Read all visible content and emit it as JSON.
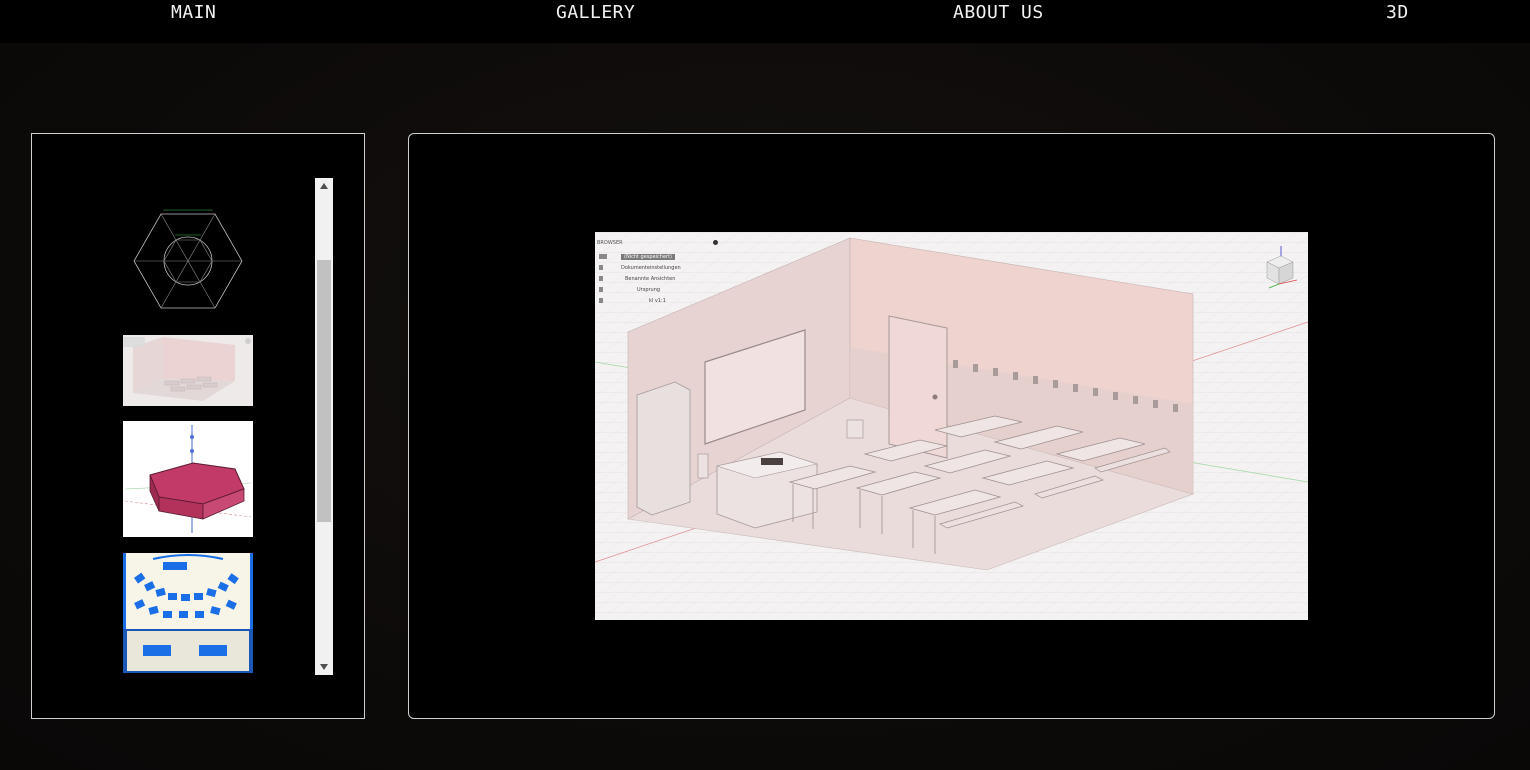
{
  "nav": {
    "items": [
      {
        "label": "MAIN"
      },
      {
        "label": "GALLERY"
      },
      {
        "label": "ABOUT US"
      },
      {
        "label": "3D"
      }
    ]
  },
  "gallery": {
    "thumbnails": [
      {
        "icon": "hexagon-sketch"
      },
      {
        "icon": "classroom-render"
      },
      {
        "icon": "pink-hexagon-prism"
      },
      {
        "icon": "seating-plan"
      }
    ]
  },
  "viewer": {
    "browser_panel": {
      "title": "BROWSER",
      "rows": [
        {
          "label": "(Nicht gespeichert)"
        },
        {
          "label": "Dokumenteinstellungen"
        },
        {
          "label": "Benannte Ansichten"
        },
        {
          "label": "Ursprung"
        },
        {
          "label": "kl v1:1"
        }
      ]
    }
  },
  "colors": {
    "background": "#0d0b0a",
    "navbar": "#000000",
    "panel_border": "#cfcfcf",
    "accent_pink": "#c23a68",
    "seat_blue": "#1a6fe6"
  }
}
